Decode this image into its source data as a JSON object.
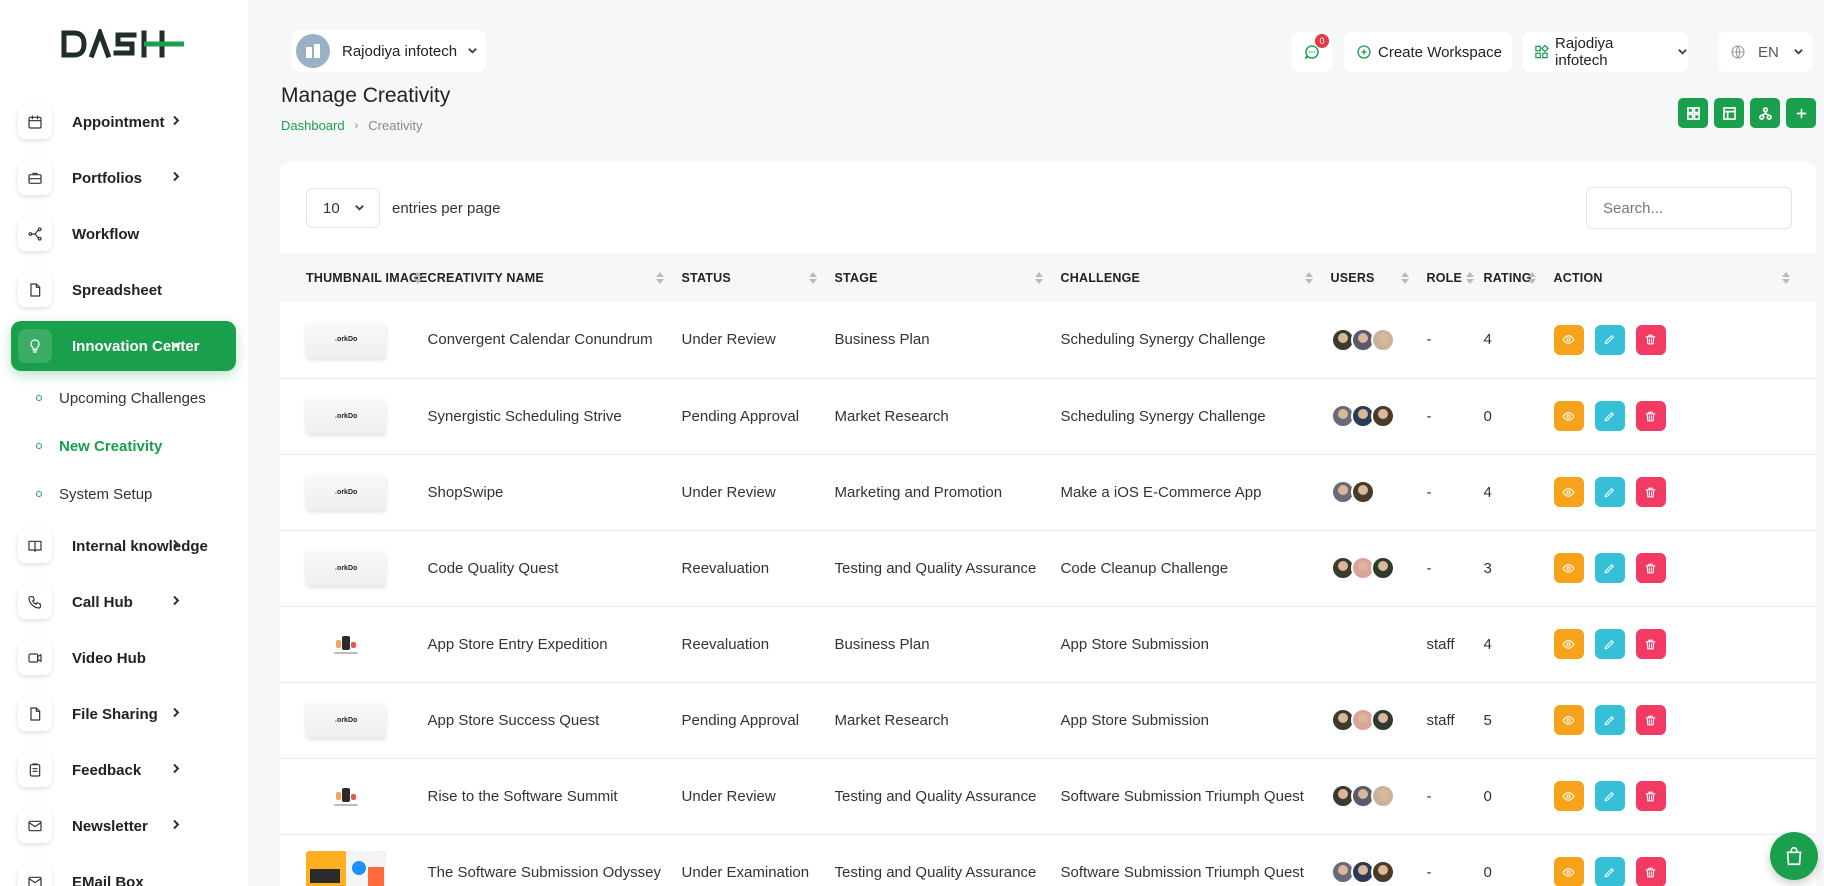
{
  "brand": {
    "logo_text": "DASH",
    "accent": "#1a9f4d"
  },
  "sidebar": {
    "items": [
      {
        "label": "Appointment",
        "icon": "calendar-icon",
        "chevron": true
      },
      {
        "label": "Portfolios",
        "icon": "briefcase-icon",
        "chevron": true
      },
      {
        "label": "Workflow",
        "icon": "workflow-icon",
        "chevron": false
      },
      {
        "label": "Spreadsheet",
        "icon": "file-icon",
        "chevron": false
      },
      {
        "label": "Innovation Center",
        "icon": "bulb-icon",
        "chevron": true,
        "active": true
      }
    ],
    "subitems": [
      {
        "label": "Upcoming Challenges"
      },
      {
        "label": "New Creativity",
        "current": true
      },
      {
        "label": "System Setup"
      }
    ],
    "items_after": [
      {
        "label": "Internal knowledge",
        "icon": "book-icon",
        "chevron": true
      },
      {
        "label": "Call Hub",
        "icon": "phone-icon",
        "chevron": true
      },
      {
        "label": "Video Hub",
        "icon": "video-icon",
        "chevron": false
      },
      {
        "label": "File Sharing",
        "icon": "file-icon",
        "chevron": true
      },
      {
        "label": "Feedback",
        "icon": "clipboard-icon",
        "chevron": true
      },
      {
        "label": "Newsletter",
        "icon": "mail-icon",
        "chevron": true
      },
      {
        "label": "EMail Box",
        "icon": "mail-icon",
        "chevron": false
      }
    ]
  },
  "header": {
    "company": "Rajodiya infotech",
    "messages_count": "0",
    "create_workspace": "Create Workspace",
    "workspace": "Rajodiya infotech",
    "language": "EN"
  },
  "page": {
    "title": "Manage Creativity",
    "breadcrumb": {
      "home": "Dashboard",
      "current": "Creativity"
    }
  },
  "table_controls": {
    "entries_value": "10",
    "entries_label": "entries per page",
    "search_placeholder": "Search..."
  },
  "table": {
    "columns": [
      "THUMBNAIL IMAGE",
      "CREATIVITY NAME",
      "STATUS",
      "STAGE",
      "CHALLENGE",
      "USERS",
      "ROLE",
      "RATING",
      "ACTION"
    ],
    "rows": [
      {
        "thumb": "workdo",
        "name": "Convergent Calendar Conundrum",
        "status": "Under Review",
        "stage": "Business Plan",
        "challenge": "Scheduling Synergy Challenge",
        "users": [
          "#3a3a2e",
          "#5a5a6a",
          "#c9b49a"
        ],
        "role": "-",
        "rating": "4"
      },
      {
        "thumb": "workdo",
        "name": "Synergistic Scheduling Strive",
        "status": "Pending Approval",
        "stage": "Market Research",
        "challenge": "Scheduling Synergy Challenge",
        "users": [
          "#6a6a7a",
          "#2b3a55",
          "#4a3a2a"
        ],
        "role": "-",
        "rating": "0"
      },
      {
        "thumb": "workdo",
        "name": "ShopSwipe",
        "status": "Under Review",
        "stage": "Marketing and Promotion",
        "challenge": "Make a iOS E-Commerce App",
        "users": [
          "#6a6a7a",
          "#4a3a2a"
        ],
        "role": "-",
        "rating": "4"
      },
      {
        "thumb": "workdo",
        "name": "Code Quality Quest",
        "status": "Reevaluation",
        "stage": "Testing and Quality Assurance",
        "challenge": "Code Cleanup Challenge",
        "users": [
          "#3a3a2e",
          "#d9a59a",
          "#2e3a2e"
        ],
        "role": "-",
        "rating": "3"
      },
      {
        "thumb": "figure",
        "name": "App Store Entry Expedition",
        "status": "Reevaluation",
        "stage": "Business Plan",
        "challenge": "App Store Submission",
        "users": [],
        "role": "staff",
        "rating": "4"
      },
      {
        "thumb": "workdo",
        "name": "App Store Success Quest",
        "status": "Pending Approval",
        "stage": "Market Research",
        "challenge": "App Store Submission",
        "users": [
          "#3a3a2e",
          "#d9a59a",
          "#2e3a2e"
        ],
        "role": "staff",
        "rating": "5"
      },
      {
        "thumb": "figure",
        "name": "Rise to the Software Summit",
        "status": "Under Review",
        "stage": "Testing and Quality Assurance",
        "challenge": "Software Submission Triumph Quest",
        "users": [
          "#3a3a2e",
          "#5a5a6a",
          "#c9b49a"
        ],
        "role": "-",
        "rating": "0"
      },
      {
        "thumb": "screenshot",
        "name": "The Software Submission Odyssey",
        "status": "Under Examination",
        "stage": "Testing and Quality Assurance",
        "challenge": "Software Submission Triumph Quest",
        "users": [
          "#6a6a7a",
          "#2b3a55",
          "#4a3a2a"
        ],
        "role": "-",
        "rating": "0"
      }
    ]
  },
  "colors": {
    "view": "#f7a21b",
    "edit": "#36bfd9",
    "delete": "#f23a63"
  }
}
